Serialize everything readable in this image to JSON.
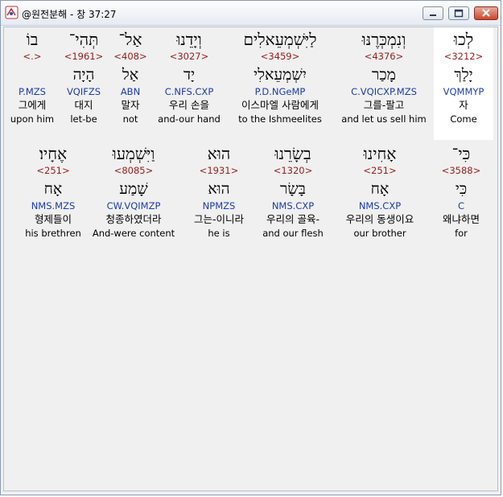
{
  "window": {
    "title": "@원전분해 - 창 37:27"
  },
  "icons": {
    "app": "app-icon",
    "minimize": "minimize-icon",
    "maximize": "maximize-icon",
    "close": "close-icon"
  },
  "colors": {
    "strong": "#9b1c1c",
    "morph": "#1a3cb0",
    "selected": "#ffffff"
  },
  "rows": [
    {
      "words": [
        {
          "heb": "לְכוּ",
          "strong": "<3212>",
          "lemma": "יָלַךְ",
          "morph": "VQMMYP",
          "ko": "자",
          "en": "Come",
          "selected": true
        },
        {
          "heb": "וְנִמְכְּרֶנּוּ",
          "strong": "<4376>",
          "lemma": "מָכַר",
          "morph": "C.VQICXP.MZS",
          "ko": "그를-팔고",
          "en": "and let us sell him"
        },
        {
          "heb": "לַיִּשְׁמְעֵאלִים",
          "strong": "<3459>",
          "lemma": "יִשְׁמְעֵאלִי",
          "morph": "P.D.NGeMP",
          "ko": "이스마엘 사람에게",
          "en": "to the Ishmeelites"
        },
        {
          "heb": "וְיָדֵנוּ",
          "strong": "<3027>",
          "lemma": "יָד",
          "morph": "C.NFS.CXP",
          "ko": "우리 손을",
          "en": "and-our hand"
        },
        {
          "heb": "אַל־",
          "strong": "<408>",
          "lemma": "אַל",
          "morph": "ABN",
          "ko": "말자",
          "en": "not"
        },
        {
          "heb": "תְּהִי־",
          "strong": "<1961>",
          "lemma": "הָיָה",
          "morph": "VQIFZS",
          "ko": "대지",
          "en": "let-be"
        },
        {
          "heb": "בוֹ",
          "strong": "<.>",
          "lemma": "",
          "morph": "P.MZS",
          "ko": "그에게",
          "en": "upon him"
        }
      ]
    },
    {
      "words": [
        {
          "heb": "כִּי־",
          "strong": "<3588>",
          "lemma": "כִּי",
          "morph": "C",
          "ko": "왜냐하면",
          "en": "for"
        },
        {
          "heb": "אָחִינוּ",
          "strong": "<251>",
          "lemma": "אָח",
          "morph": "NMS.CXP",
          "ko": "우리의 동생이요",
          "en": "our brother"
        },
        {
          "heb": "בְשָׂרֵנוּ",
          "strong": "<1320>",
          "lemma": "בָּשָׂר",
          "morph": "NMS.CXP",
          "ko": "우리의 골육-",
          "en": "and our flesh"
        },
        {
          "heb": "הוּא",
          "strong": "<1931>",
          "lemma": "הוּא",
          "morph": "NPMZS",
          "ko": "그는-이니라",
          "en": "he is"
        },
        {
          "heb": "וַיִּשְׁמְעוּ",
          "strong": "<8085>",
          "lemma": "שָׁמַע",
          "morph": "CW.VQIMZP",
          "ko": "청종하였더라",
          "en": "And-were content"
        },
        {
          "heb": "אֶחָיו׃",
          "strong": "<251>",
          "lemma": "אָח",
          "morph": "NMS.MZS",
          "ko": "형제들이",
          "en": "his brethren"
        }
      ]
    }
  ]
}
